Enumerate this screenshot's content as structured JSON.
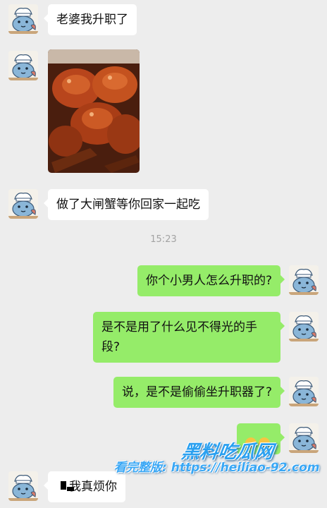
{
  "messages": {
    "m1": "老婆我升职了",
    "m3": "做了大闸蟹等你回家一起吃",
    "m4": "你个小男人怎么升职的?",
    "m5": "是不是用了什么见不得光的手段?",
    "m6": "说，是不是偷偷坐升职器了?",
    "m8": "我真烦你"
  },
  "timestamp": "15:23",
  "watermark": {
    "brand": "黑料吃瓜网",
    "label": "看完整版: https://heiliao-92.com"
  },
  "icons": {
    "avatar": "cartoon-fish-chef-avatar",
    "photo": "braised-crab-photo",
    "emoji": "grimace-emoji"
  },
  "colors": {
    "background": "#ededed",
    "incoming_bubble": "#ffffff",
    "outgoing_bubble": "#95ec69",
    "timestamp": "#a3a3a3",
    "watermark": "#2aa0f0"
  }
}
